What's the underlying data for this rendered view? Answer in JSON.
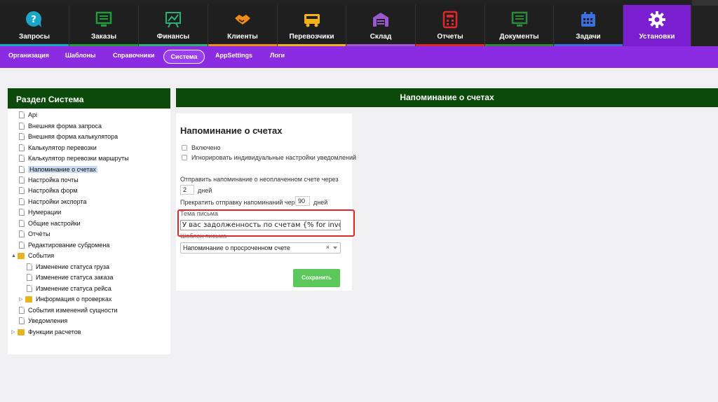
{
  "nav": [
    {
      "label": "Запросы",
      "icon": "chat-question-icon",
      "color": "#1aa6c9",
      "active": false
    },
    {
      "label": "Заказы",
      "icon": "monitor-list-icon",
      "color": "#1f9d3a",
      "active": false
    },
    {
      "label": "Финансы",
      "icon": "chart-board-icon",
      "color": "#2bb07a",
      "active": false
    },
    {
      "label": "Клиенты",
      "icon": "handshake-icon",
      "color": "#f08a1a",
      "active": false
    },
    {
      "label": "Перевозчики",
      "icon": "truck-icon",
      "color": "#f2b318",
      "active": false
    },
    {
      "label": "Склад",
      "icon": "warehouse-icon",
      "color": "#9b59d0",
      "active": false
    },
    {
      "label": "Отчеты",
      "icon": "calculator-icon",
      "color": "#e0282b",
      "active": false
    },
    {
      "label": "Документы",
      "icon": "document-list-icon",
      "color": "#2a8a3a",
      "active": false
    },
    {
      "label": "Задачи",
      "icon": "calendar-icon",
      "color": "#3b6fe0",
      "active": false
    },
    {
      "label": "Установки",
      "icon": "gear-icon",
      "color": "#ffffff",
      "active": true
    }
  ],
  "subnav": {
    "items": [
      "Организация",
      "Шаблоны",
      "Справочники"
    ],
    "active": "Система",
    "after": [
      "AppSettings",
      "Логи"
    ]
  },
  "left_panel": {
    "title": "Раздел Система",
    "items": [
      {
        "label": "Api",
        "type": "doc",
        "level": 0
      },
      {
        "label": "Внешняя форма запроса",
        "type": "doc",
        "level": 0
      },
      {
        "label": "Внешняя форма калькулятора",
        "type": "doc",
        "level": 0
      },
      {
        "label": "Калькулятор перевозки",
        "type": "doc",
        "level": 0
      },
      {
        "label": "Калькулятор перевозки маршруты",
        "type": "doc",
        "level": 0
      },
      {
        "label": "Напоминание о счетах",
        "type": "doc",
        "level": 0,
        "selected": true
      },
      {
        "label": "Настройка почты",
        "type": "doc",
        "level": 0
      },
      {
        "label": "Настройка форм",
        "type": "doc",
        "level": 0
      },
      {
        "label": "Настройки экспорта",
        "type": "doc",
        "level": 0
      },
      {
        "label": "Нумерации",
        "type": "doc",
        "level": 0
      },
      {
        "label": "Общие настройки",
        "type": "doc",
        "level": 0
      },
      {
        "label": "Отчёты",
        "type": "doc",
        "level": 0
      },
      {
        "label": "Редактирование субдомена",
        "type": "doc",
        "level": 0
      },
      {
        "label": "События",
        "type": "folder",
        "level": 0,
        "arrow": "▲"
      },
      {
        "label": "Изменение статуса груза",
        "type": "doc",
        "level": 1
      },
      {
        "label": "Изменение статуса заказа",
        "type": "doc",
        "level": 1
      },
      {
        "label": "Изменение статуса рейса",
        "type": "doc",
        "level": 1
      },
      {
        "label": "Информация о проверках",
        "type": "folder",
        "level": 1,
        "arrow": "▷"
      },
      {
        "label": "События изменений сущности",
        "type": "doc",
        "level": 0
      },
      {
        "label": "Уведомления",
        "type": "doc",
        "level": 0
      },
      {
        "label": "Функции расчетов",
        "type": "folder",
        "level": 0,
        "arrow": "▷"
      }
    ]
  },
  "main": {
    "header": "Напоминание о счетах",
    "form": {
      "title": "Напоминание о счетах",
      "enabled_label": "Включено",
      "ignore_label": "Игнорировать индивидуальные настройки уведомлений",
      "send_label": "Отправить напоминание о неоплаченном счете через",
      "send_value": "2",
      "days_label": "дней",
      "stop_label": "Прекратить отправку напоминаний через",
      "stop_value": "90",
      "subject_label": "Тема письма",
      "subject_value": "У вас задолженность по счетам {% for invoice in invoi",
      "template_label": "Шаблон письма",
      "template_value": "Напоминание о просроченном счете",
      "clear_glyph": "×",
      "save_label": "Сохранить"
    }
  },
  "colors": {
    "dark_green": "#0b4a0b",
    "purple": "#8b2be2",
    "save_green": "#5cc85c",
    "highlight_red": "#e0282b"
  }
}
